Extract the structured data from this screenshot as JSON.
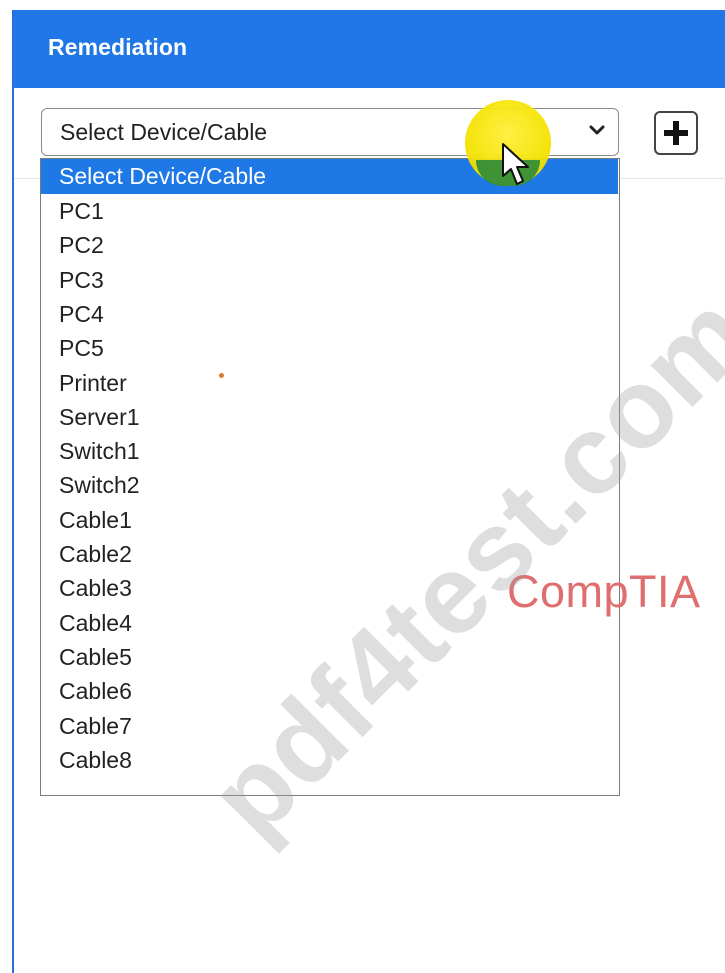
{
  "panel": {
    "title": "Remediation"
  },
  "device_select": {
    "value": "Select Device/Cable",
    "options": [
      "Select Device/Cable",
      "PC1",
      "PC2",
      "PC3",
      "PC4",
      "PC5",
      "Printer",
      "Server1",
      "Switch1",
      "Switch2",
      "Cable1",
      "Cable2",
      "Cable3",
      "Cable4",
      "Cable5",
      "Cable6",
      "Cable7",
      "Cable8"
    ],
    "highlighted_option": "Select Device/Cable"
  },
  "add_button": {
    "icon": "plus-icon"
  },
  "watermark": {
    "text": "pdf4test.com"
  },
  "brand": {
    "text": "CompTIA"
  },
  "colors": {
    "header": "#1f77e8",
    "highlight": "#1e78e6",
    "brand": "#e06e6e"
  }
}
